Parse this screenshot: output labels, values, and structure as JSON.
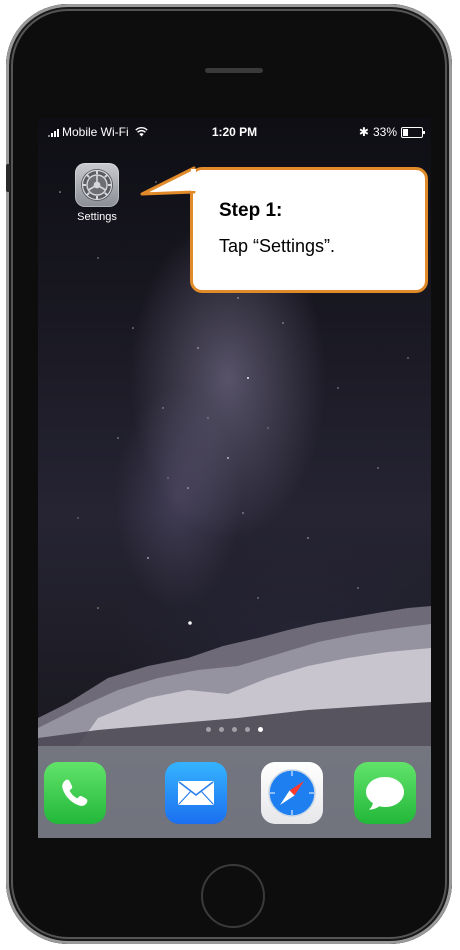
{
  "status_bar": {
    "carrier": "Mobile Wi-Fi",
    "time": "1:20 PM",
    "bluetooth": "✱",
    "battery_percent": "33%",
    "battery_level": 0.33
  },
  "home_screen": {
    "apps": [
      {
        "label": "Settings",
        "icon": "settings-gear-icon"
      }
    ],
    "page_dots": {
      "count": 5,
      "active_index": 4
    },
    "dock": [
      {
        "name": "Phone",
        "icon": "phone-icon"
      },
      {
        "name": "Mail",
        "icon": "mail-icon"
      },
      {
        "name": "Safari",
        "icon": "safari-compass-icon"
      },
      {
        "name": "Messages",
        "icon": "messages-icon"
      }
    ]
  },
  "callout": {
    "title": "Step 1:",
    "body": "Tap “Settings”."
  },
  "colors": {
    "callout_border": "#e08a2a",
    "phone_green": "#22b83a",
    "mail_blue": "#1b6ff0",
    "frame": "#0d0d0d"
  }
}
